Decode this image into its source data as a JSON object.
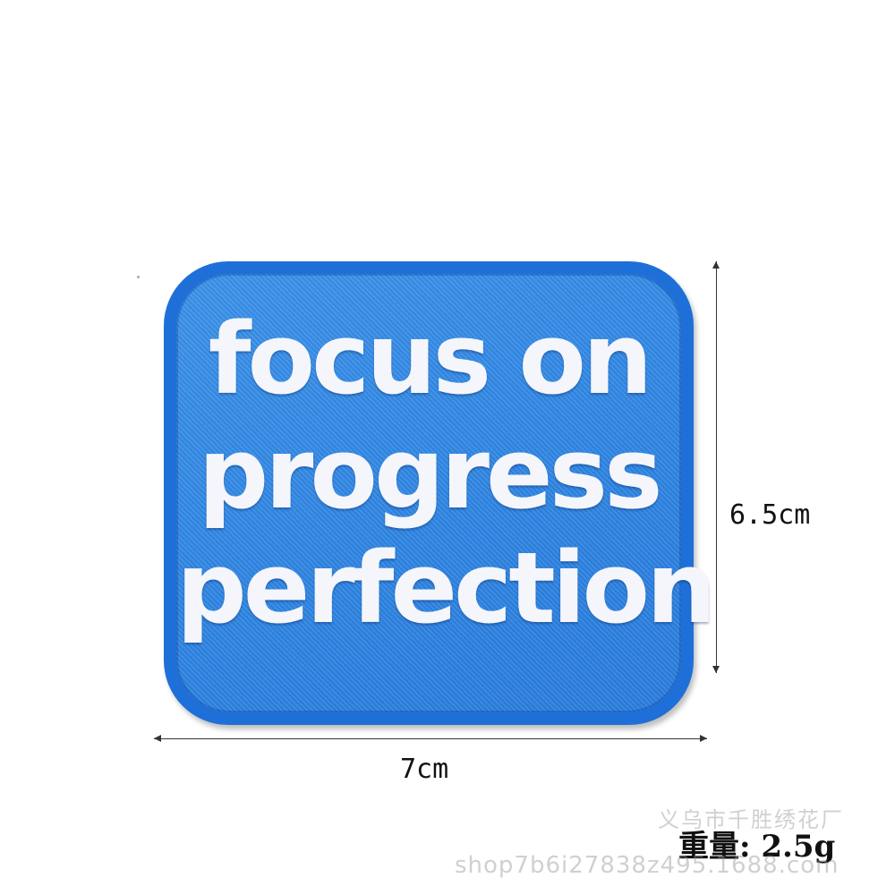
{
  "patch": {
    "lines": [
      "focus on",
      "progress",
      "perfection"
    ],
    "colors": {
      "border": "#1f6fd8",
      "fill": "#3589e6",
      "text": "#f4f6fb"
    }
  },
  "dimensions": {
    "height": "6.5cm",
    "width": "7cm",
    "weight": "重量: 2.5g"
  },
  "watermark": {
    "company": "义乌市千胜绣花厂",
    "shop_url": "shop7b6i27838z495.1688.com"
  }
}
